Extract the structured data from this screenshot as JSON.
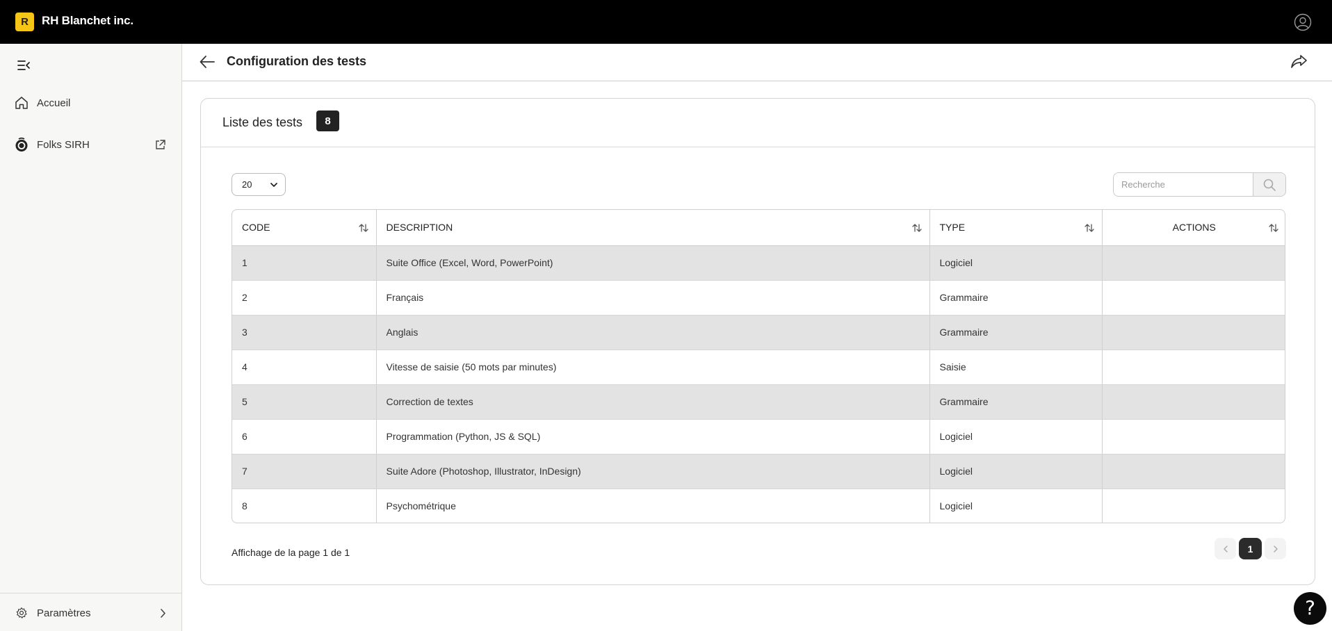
{
  "app": {
    "logo_letter": "R",
    "company_name": "RH Blanchet inc."
  },
  "sidebar": {
    "items": [
      {
        "label": "Accueil",
        "icon": "home-icon"
      },
      {
        "label": "Folks SIRH",
        "icon": "folks-logo-icon",
        "external": true
      }
    ],
    "footer_item": {
      "label": "Paramètres",
      "icon": "gear-icon"
    }
  },
  "header": {
    "title": "Configuration des tests"
  },
  "card": {
    "title": "Liste des tests",
    "count": "8"
  },
  "controls": {
    "page_size": "20",
    "search_placeholder": "Recherche"
  },
  "table": {
    "columns": [
      "CODE",
      "DESCRIPTION",
      "TYPE",
      "ACTIONS"
    ],
    "rows": [
      {
        "code": "1",
        "description": "Suite Office (Excel, Word, PowerPoint)",
        "type": "Logiciel",
        "actions": ""
      },
      {
        "code": "2",
        "description": "Français",
        "type": "Grammaire",
        "actions": ""
      },
      {
        "code": "3",
        "description": "Anglais",
        "type": "Grammaire",
        "actions": ""
      },
      {
        "code": "4",
        "description": "Vitesse de saisie (50 mots par minutes)",
        "type": "Saisie",
        "actions": ""
      },
      {
        "code": "5",
        "description": "Correction de textes",
        "type": "Grammaire",
        "actions": ""
      },
      {
        "code": "6",
        "description": "Programmation (Python, JS & SQL)",
        "type": "Logiciel",
        "actions": ""
      },
      {
        "code": "7",
        "description": "Suite Adore (Photoshop, Illustrator, InDesign)",
        "type": "Logiciel",
        "actions": ""
      },
      {
        "code": "8",
        "description": "Psychométrique",
        "type": "Logiciel",
        "actions": ""
      }
    ]
  },
  "pagination": {
    "info": "Affichage de la page 1 de 1",
    "current_page": "1"
  },
  "help": {
    "symbol": "?"
  },
  "colors": {
    "topbar": "#000000",
    "logo_accent": "#f5c518",
    "row_stripe": "#e3e3e3",
    "dark_badge": "#222222"
  }
}
